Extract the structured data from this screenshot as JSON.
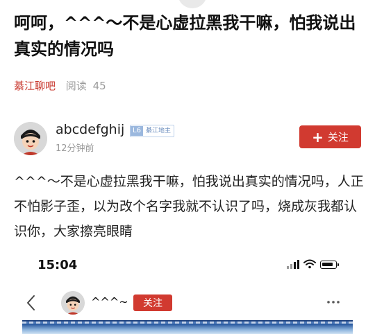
{
  "article": {
    "title": "呵呵，^^^～不是心虚拉黑我干嘛，怕我说出真实的情况吗",
    "source": "綦江聊吧",
    "reads_label": "阅读",
    "reads_count": "45"
  },
  "author": {
    "name": "abcdefghij",
    "level": "L6",
    "role": "綦江地主",
    "time": "12分钟前",
    "follow_label": "关注",
    "follow_icon": "plus-icon"
  },
  "post": {
    "content": "^^^～不是心虚拉黑我干嘛，怕我说出真实的情况吗，人正不怕影子歪，以为改个名字我就不认识了吗，烧成灰我都认识你，大家擦亮眼睛"
  },
  "embedded_screenshot": {
    "status_time": "15:04",
    "status_icons": [
      "signal-icon",
      "wifi-icon",
      "battery-icon"
    ],
    "nav": {
      "back_icon": "chevron-left-icon",
      "user_name": "^^^~",
      "follow_label": "关注",
      "more_icon": "more-icon"
    }
  },
  "colors": {
    "accent_red": "#d13a30",
    "source_red": "#c8372d",
    "muted_gray": "#9a9a9a",
    "badge_blue": "#9bb8de"
  }
}
